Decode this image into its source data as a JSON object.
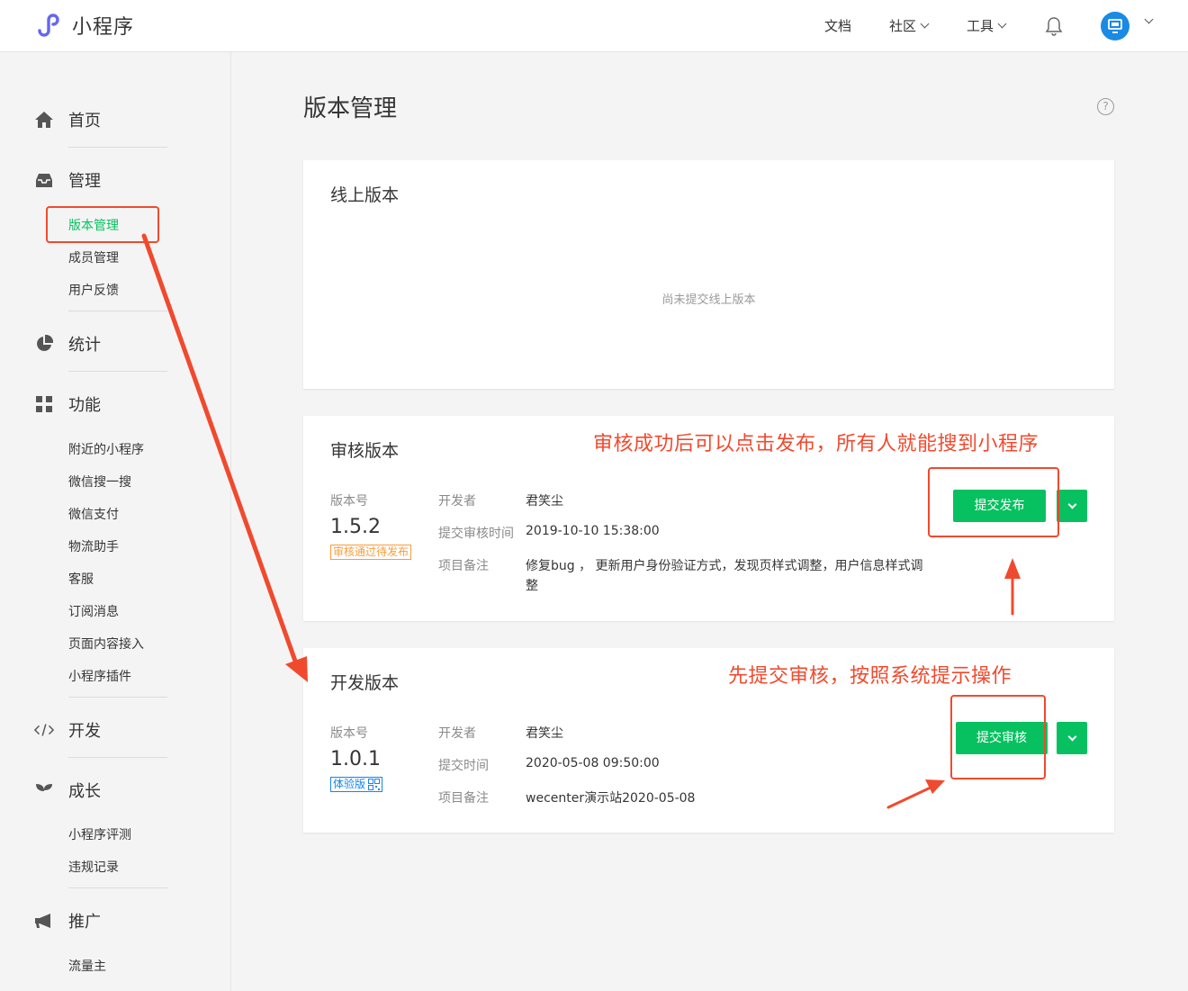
{
  "app": {
    "title": "小程序"
  },
  "topnav": {
    "docs": "文档",
    "community": "社区",
    "tools": "工具"
  },
  "sidebar": {
    "home": "首页",
    "manage": "管理",
    "manage_items": [
      "版本管理",
      "成员管理",
      "用户反馈"
    ],
    "stats": "统计",
    "features": "功能",
    "feature_items": [
      "附近的小程序",
      "微信搜一搜",
      "微信支付",
      "物流助手",
      "客服",
      "订阅消息",
      "页面内容接入",
      "小程序插件"
    ],
    "develop": "开发",
    "growth": "成长",
    "growth_items": [
      "小程序评测",
      "违规记录"
    ],
    "promote": "推广",
    "promote_items": [
      "流量主"
    ]
  },
  "page": {
    "title": "版本管理",
    "help": "?"
  },
  "online": {
    "title": "线上版本",
    "empty": "尚未提交线上版本"
  },
  "review": {
    "title": "审核版本",
    "version_label": "版本号",
    "version": "1.5.2",
    "status": "审核通过待发布",
    "developer_label": "开发者",
    "developer": "君笑尘",
    "time_label": "提交审核时间",
    "time": "2019-10-10 15:38:00",
    "note_label": "项目备注",
    "note_line1": "修复bug ， 更新用户身份验证方式，发现页样式调整，用户信息样式调",
    "note_line2": "整",
    "button": "提交发布"
  },
  "dev": {
    "title": "开发版本",
    "version_label": "版本号",
    "version": "1.0.1",
    "status": "体验版",
    "developer_label": "开发者",
    "developer": "君笑尘",
    "time_label": "提交时间",
    "time": "2020-05-08 09:50:00",
    "note_label": "项目备注",
    "note": "wecenter演示站2020-05-08",
    "button": "提交审核"
  },
  "annotations": {
    "publish_hint": "审核成功后可以点击发布，所有人就能搜到小程序",
    "submit_hint": "先提交审核，按照系统提示操作"
  },
  "colors": {
    "green": "#07c160",
    "annot": "#f04a2e",
    "orange": "#fa9d3b",
    "blue": "#1485ee"
  }
}
